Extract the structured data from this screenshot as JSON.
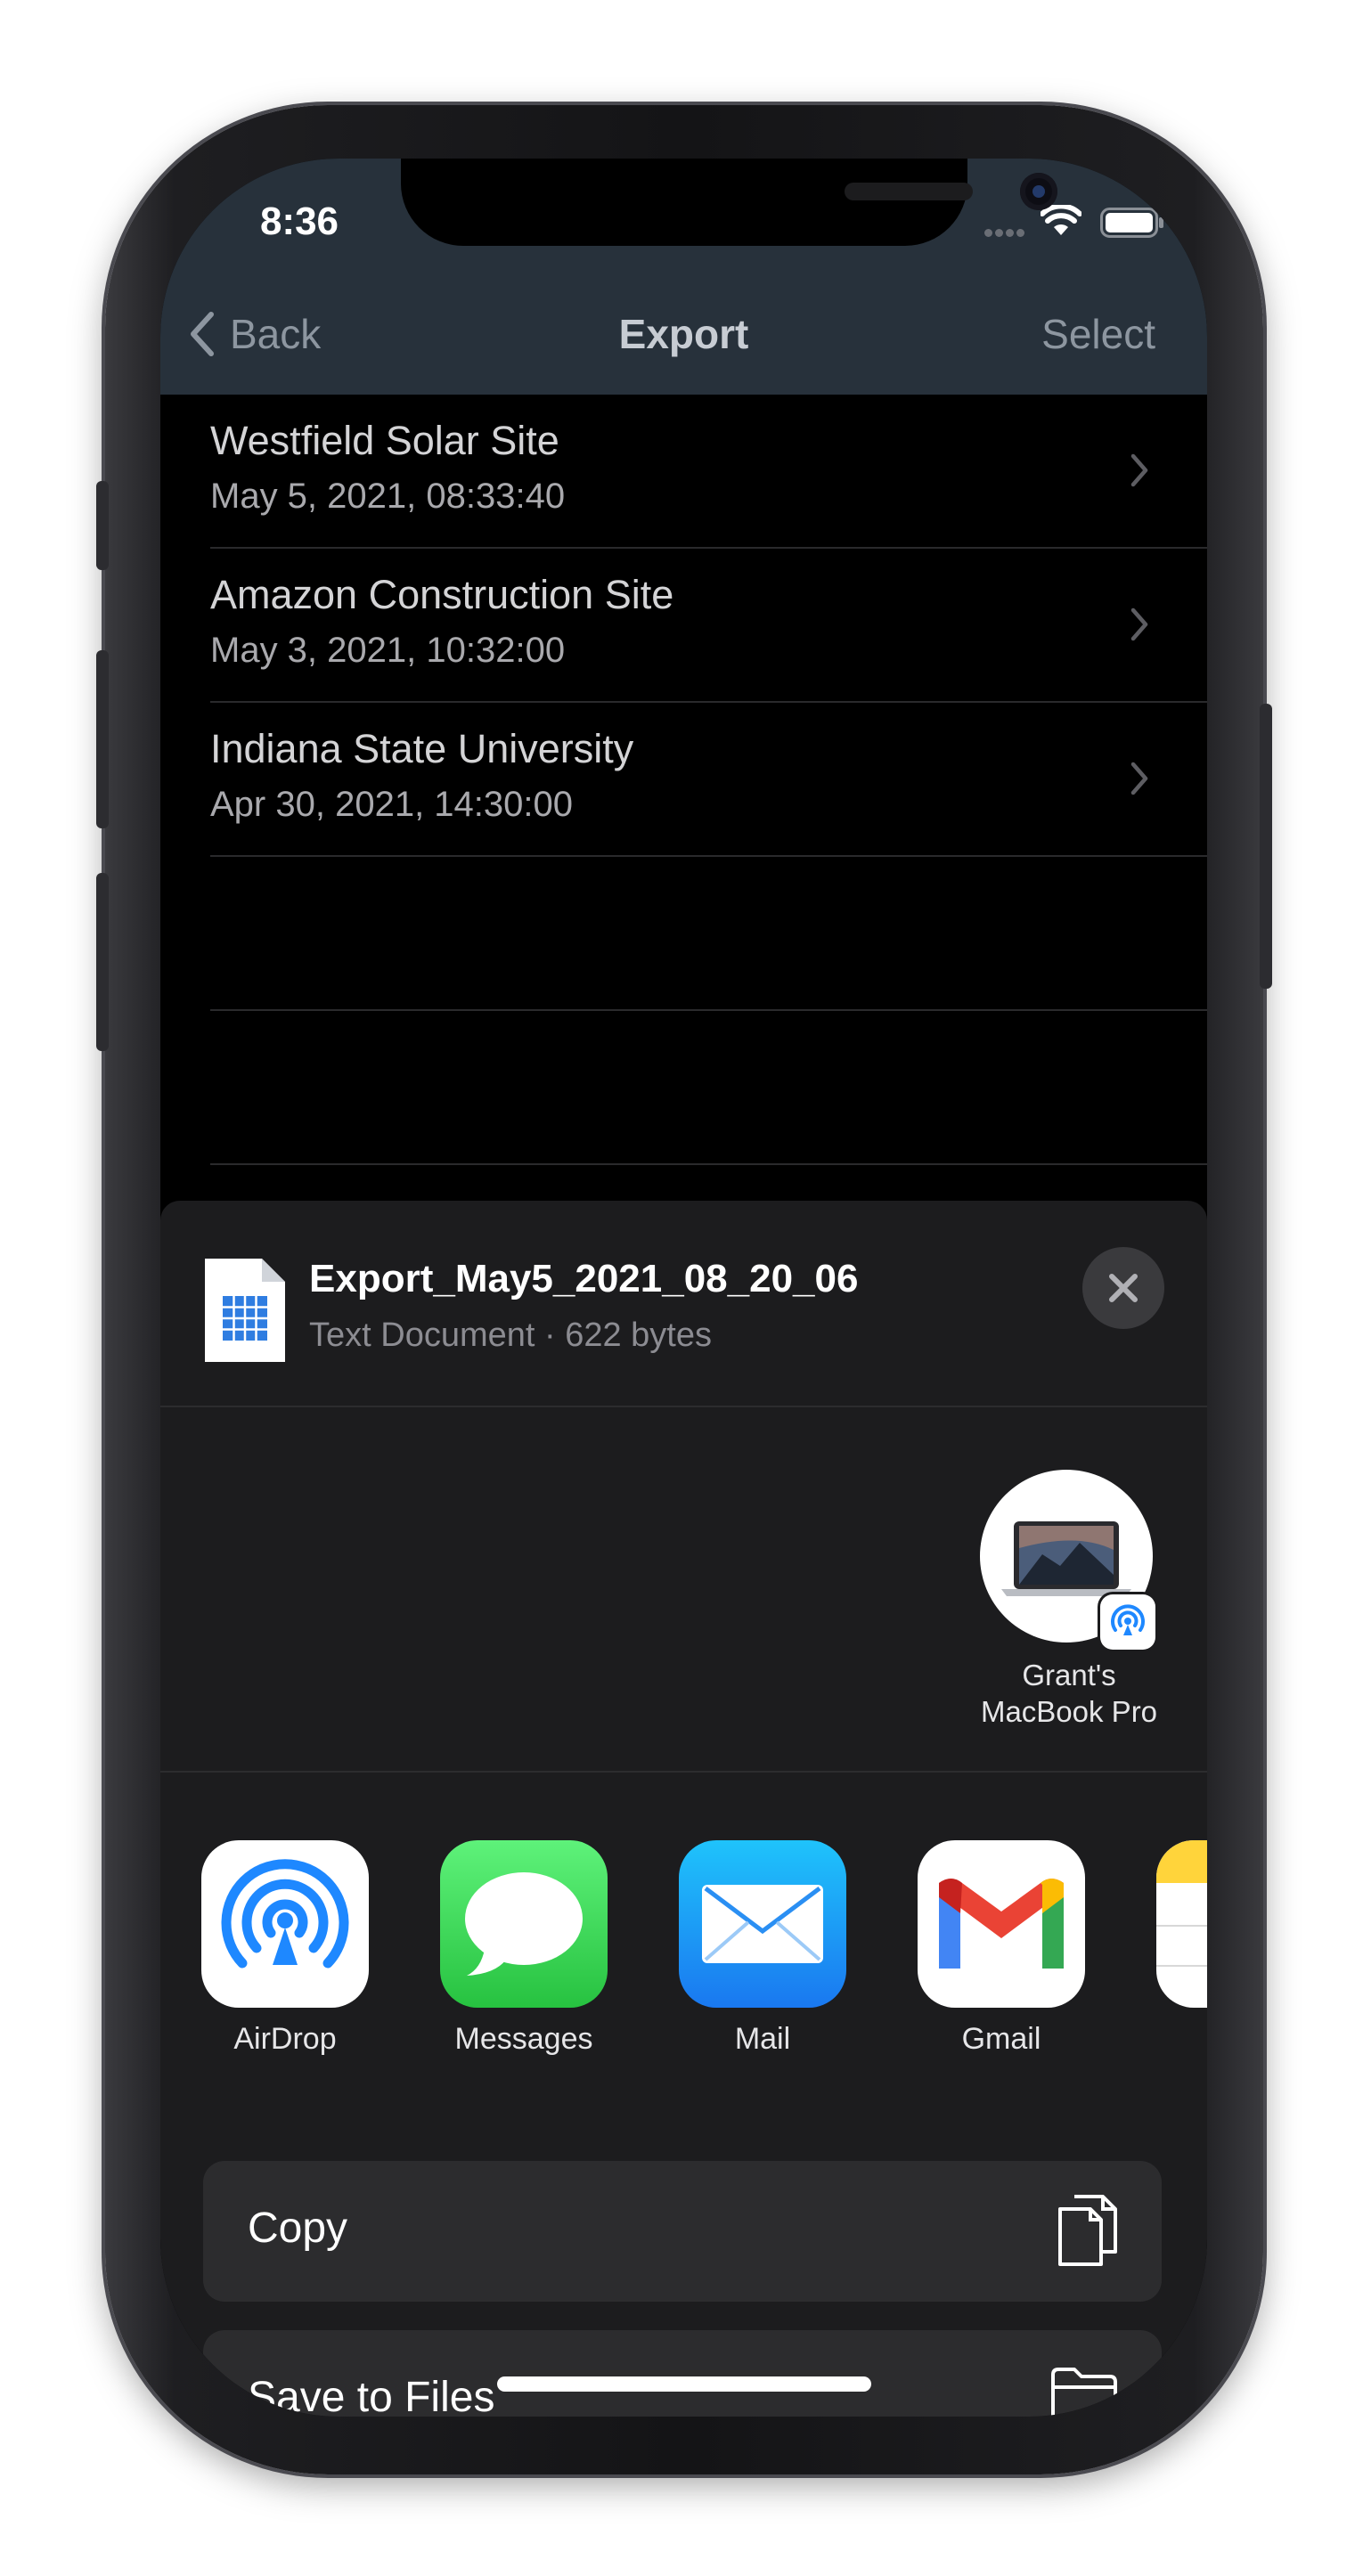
{
  "status_bar": {
    "time": "8:36"
  },
  "navbar": {
    "back_label": "Back",
    "title": "Export",
    "select_label": "Select"
  },
  "exports": [
    {
      "title": "Westfield Solar Site",
      "date": "May 5, 2021, 08:33:40"
    },
    {
      "title": "Amazon Construction Site",
      "date": "May 3, 2021, 10:32:00"
    },
    {
      "title": "Indiana State University",
      "date": "Apr 30, 2021, 14:30:00"
    }
  ],
  "share_sheet": {
    "file_name": "Export_May5_2021_08_20_06",
    "file_info": "Text Document · 622 bytes",
    "airdrop_device": {
      "name_line1": "Grant's",
      "name_line2": "MacBook Pro"
    },
    "apps": [
      "AirDrop",
      "Messages",
      "Mail",
      "Gmail"
    ],
    "actions": [
      "Copy",
      "Save to Files"
    ]
  },
  "icons": {
    "back": "chevron-left-icon",
    "row": "chevron-right-icon",
    "close": "close-icon",
    "copy": "copy-icon",
    "save": "folder-icon",
    "document": "spreadsheet-document-icon"
  },
  "colors": {
    "navbar": "#27313b",
    "sheet": "#1c1c1e",
    "accent_airdrop": "#1e88ff",
    "messages_green": "#34c759",
    "mail_blue": "#1e9bf5"
  }
}
